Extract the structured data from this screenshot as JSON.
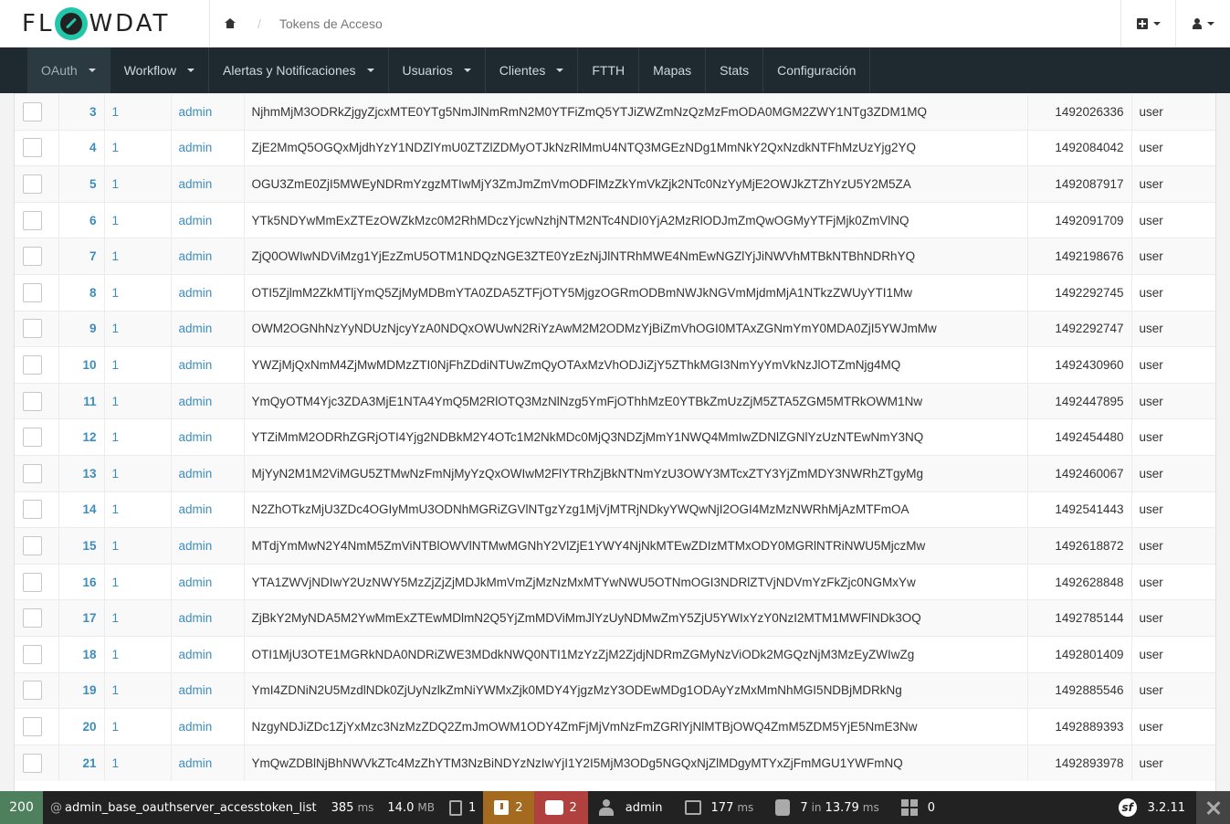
{
  "header": {
    "logo_text_left": "FL",
    "logo_text_right": "WDAT",
    "breadcrumb_sep": "/",
    "breadcrumb_current": "Tokens de Acceso"
  },
  "nav": {
    "items": [
      {
        "label": "OAuth",
        "dropdown": true,
        "active": true
      },
      {
        "label": "Workflow",
        "dropdown": true
      },
      {
        "label": "Alertas y Notificaciones",
        "dropdown": true
      },
      {
        "label": "Usuarios",
        "dropdown": true
      },
      {
        "label": "Clientes",
        "dropdown": true
      },
      {
        "label": "FTTH",
        "dropdown": false
      },
      {
        "label": "Mapas",
        "dropdown": false
      },
      {
        "label": "Stats",
        "dropdown": false
      },
      {
        "label": "Configuración",
        "dropdown": false
      }
    ]
  },
  "table": {
    "rows": [
      {
        "id": "3",
        "client": "1",
        "user": "admin",
        "token": "NjhmMjM3ODRkZjgyZjcxMTE0YTg5NmJlNmRmN2M0YTFiZmQ5YTJiZWZmNzQzMzFmODA0MGM2ZWY1NTg3ZDM1MQ",
        "expires": "1492026336",
        "scope": "user"
      },
      {
        "id": "4",
        "client": "1",
        "user": "admin",
        "token": "ZjE2MmQ5OGQxMjdhYzY1NDZlYmU0ZTZlZDMyOTJkNzRlMmU4NTQ3MGEzNDg1MmNkY2QxNzdkNTFhMzUzYjg2YQ",
        "expires": "1492084042",
        "scope": "user"
      },
      {
        "id": "5",
        "client": "1",
        "user": "admin",
        "token": "OGU3ZmE0ZjI5MWEyNDRmYzgzMTIwMjY3ZmJmZmVmODFlMzZkYmVkZjk2NTc0NzYyMjE2OWJkZTZhYzU5Y2M5ZA",
        "expires": "1492087917",
        "scope": "user"
      },
      {
        "id": "6",
        "client": "1",
        "user": "admin",
        "token": "YTk5NDYwMmExZTEzOWZkMzc0M2RhMDczYjcwNzhjNTM2NTc4NDI0YjA2MzRlODJmZmQwOGMyYTFjMjk0ZmVlNQ",
        "expires": "1492091709",
        "scope": "user"
      },
      {
        "id": "7",
        "client": "1",
        "user": "admin",
        "token": "ZjQ0OWIwNDViMzg1YjEzZmU5OTM1NDQzNGE3ZTE0YzEzNjJlNTRhMWE4NmEwNGZlYjJiNWVhMTBkNTBhNDRhYQ",
        "expires": "1492198676",
        "scope": "user"
      },
      {
        "id": "8",
        "client": "1",
        "user": "admin",
        "token": "OTI5ZjlmM2ZkMTljYmQ5ZjMyMDBmYTA0ZDA5ZTFjOTY5MjgzOGRmODBmNWJkNGVmMjdmMjA1NTkzZWUyYTI1Mw",
        "expires": "1492292745",
        "scope": "user"
      },
      {
        "id": "9",
        "client": "1",
        "user": "admin",
        "token": "OWM2OGNhNzYyNDUzNjcyYzA0NDQxOWUwN2RiYzAwM2M2ODMzYjBiZmVhOGI0MTAxZGNmYmY0MDA0ZjI5YWJmMw",
        "expires": "1492292747",
        "scope": "user"
      },
      {
        "id": "10",
        "client": "1",
        "user": "admin",
        "token": "YWZjMjQxNmM4ZjMwMDMzZTI0NjFhZDdiNTUwZmQyOTAxMzVhODJiZjY5ZThkMGI3NmYyYmVkNzJlOTZmNjg4MQ",
        "expires": "1492430960",
        "scope": "user"
      },
      {
        "id": "11",
        "client": "1",
        "user": "admin",
        "token": "YmQyOTM4Yjc3ZDA3MjE1NTA4YmQ5M2RlOTQ3MzNlNzg5YmFjOThhMzE0YTBkZmUzZjM5ZTA5ZGM5MTRkOWM1Nw",
        "expires": "1492447895",
        "scope": "user"
      },
      {
        "id": "12",
        "client": "1",
        "user": "admin",
        "token": "YTZiMmM2ODRhZGRjOTI4Yjg2NDBkM2Y4OTc1M2NkMDc0MjQ3NDZjMmY1NWQ4MmIwZDNlZGNlYzUzNTEwNmY3NQ",
        "expires": "1492454480",
        "scope": "user"
      },
      {
        "id": "13",
        "client": "1",
        "user": "admin",
        "token": "MjYyN2M1M2ViMGU5ZTMwNzFmNjMyYzQxOWIwM2FlYTRhZjBkNTNmYzU3OWY3MTcxZTY3YjZmMDY3NWRhZTgyMg",
        "expires": "1492460067",
        "scope": "user"
      },
      {
        "id": "14",
        "client": "1",
        "user": "admin",
        "token": "N2ZhOTkzMjU3ZDc4OGIyMmU3ODNhMGRiZGVlNTgzYzg1MjVjMTRjNDkyYWQwNjI2OGI4MzMzNWRhMjAzMTFmOA",
        "expires": "1492541443",
        "scope": "user"
      },
      {
        "id": "15",
        "client": "1",
        "user": "admin",
        "token": "MTdjYmMwN2Y4NmM5ZmViNTBlOWVlNTMwMGNhY2VlZjE1YWY4NjNkMTEwZDIzMTMxODY0MGRlNTRiNWU5MjczMw",
        "expires": "1492618872",
        "scope": "user"
      },
      {
        "id": "16",
        "client": "1",
        "user": "admin",
        "token": "YTA1ZWVjNDIwY2UzNWY5MzZjZjZjMDJkMmVmZjMzNzMxMTYwNWU5OTNmOGI3NDRlZTVjNDVmYzFkZjc0NGMxYw",
        "expires": "1492628848",
        "scope": "user"
      },
      {
        "id": "17",
        "client": "1",
        "user": "admin",
        "token": "ZjBkY2MyNDA5M2YwMmExZTEwMDlmN2Q5YjZmMDViMmJlYzUyNDMwZmY5ZjU5YWIxYzY0NzI2MTM1MWFlNDk3OQ",
        "expires": "1492785144",
        "scope": "user"
      },
      {
        "id": "18",
        "client": "1",
        "user": "admin",
        "token": "OTI1MjU3OTE1MGRkNDA0NDRiZWE3MDdkNWQ0NTI1MzYzZjM2ZjdjNDRmZGMyNzViODk2MGQzNjM3MzEyZWIwZg",
        "expires": "1492801409",
        "scope": "user"
      },
      {
        "id": "19",
        "client": "1",
        "user": "admin",
        "token": "YmI4ZDNiN2U5MzdlNDk0ZjUyNzlkZmNiYWMxZjk0MDY4YjgzMzY3ODEwMDg1ODAyYzMxMmNhMGI5NDBjMDRkNg",
        "expires": "1492885546",
        "scope": "user"
      },
      {
        "id": "20",
        "client": "1",
        "user": "admin",
        "token": "NzgyNDJiZDc1ZjYxMzc3NzMzZDQ2ZmJmOWM1ODY4ZmFjMjVmNzFmZGRlYjNlMTBjOWQ4ZmM5ZDM5YjE5NmE3Nw",
        "expires": "1492889393",
        "scope": "user"
      },
      {
        "id": "21",
        "client": "1",
        "user": "admin",
        "token": "YmQwZDBlNjBhNWVkZTc4MzZhYTM3NzBiNDYzNzIwYjI1Y2I5MjM3ODg5NGQxNjZlMDgyMTYxZjFmMGU1YWFmNQ",
        "expires": "1492893978",
        "scope": "user"
      }
    ]
  },
  "sftoolbar": {
    "status": "200",
    "route_at": "@",
    "route": "admin_base_oauthserver_accesstoken_list",
    "time": "385",
    "time_unit": "ms",
    "memory": "14.0",
    "memory_unit": "MB",
    "forms": "1",
    "logs_warnings": "2",
    "translation_errors": "2",
    "user": "admin",
    "twig_time": "177",
    "twig_unit": "ms",
    "db_queries": "7",
    "db_in": "in",
    "db_time": "13.79",
    "db_unit": "ms",
    "cache": "0",
    "sf_logo": "sf",
    "sf_version": "3.2.11"
  },
  "colors": {
    "link": "#3c8dbc",
    "nav_bg": "#1e2a30",
    "status_ok": "#4f805d",
    "warning": "#a46a1f",
    "error": "#b0413e",
    "brand": "#22c7a9"
  },
  "icons": {
    "home": "home-icon",
    "add": "plus-square-icon",
    "user": "user-icon",
    "close": "close-icon"
  }
}
